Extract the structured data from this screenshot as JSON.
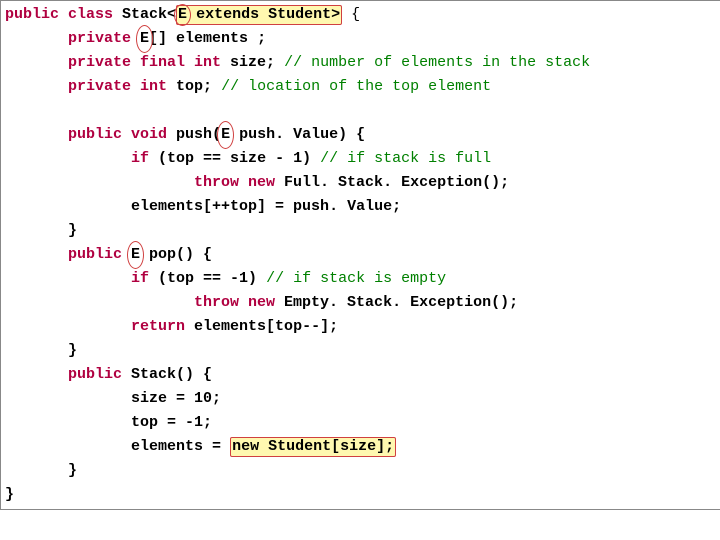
{
  "line1": {
    "a": "public class ",
    "b": "Stack<",
    "c": "E",
    "d": " extends Student>",
    "e": " {"
  },
  "line2": {
    "indent": "       ",
    "a": "private ",
    "b": "E",
    "c": "[] elements ;"
  },
  "line3": {
    "indent": "       ",
    "a": "private final int ",
    "b": "size; ",
    "c": "// number of elements in the stack"
  },
  "line4": {
    "indent": "       ",
    "a": "private int ",
    "b": "top; ",
    "c": "// location of the top element"
  },
  "line6": {
    "indent": "       ",
    "a": "public void ",
    "b": "push(",
    "c": "E",
    "d": " push. Value) {"
  },
  "line7": {
    "indent": "              ",
    "a": "if ",
    "b": "(top == size - 1) ",
    "c": "// if stack is full"
  },
  "line8": {
    "indent": "                     ",
    "a": "throw new ",
    "b": "Full. Stack. Exception();"
  },
  "line9": {
    "indent": "              ",
    "a": "elements[++top] = push. Value;"
  },
  "line10": {
    "indent": "       ",
    "a": "}"
  },
  "line11": {
    "indent": "       ",
    "a": "public ",
    "b": "E",
    "c": " pop() {"
  },
  "line12": {
    "indent": "              ",
    "a": "if ",
    "b": "(top == -1) ",
    "c": "// if stack is empty"
  },
  "line13": {
    "indent": "                     ",
    "a": "throw new ",
    "b": "Empty. Stack. Exception();"
  },
  "line14": {
    "indent": "              ",
    "a": "return ",
    "b": "elements[top--];"
  },
  "line15": {
    "indent": "       ",
    "a": "}"
  },
  "line16": {
    "indent": "       ",
    "a": "public ",
    "b": "Stack() {"
  },
  "line17": {
    "indent": "              ",
    "a": "size = 10;"
  },
  "line18": {
    "indent": "              ",
    "a": "top = -1;"
  },
  "line19": {
    "indent": "              ",
    "a": "elements = ",
    "b": "new Student[size];"
  },
  "line20": {
    "indent": "       ",
    "a": "}"
  },
  "line21": {
    "a": "}"
  }
}
